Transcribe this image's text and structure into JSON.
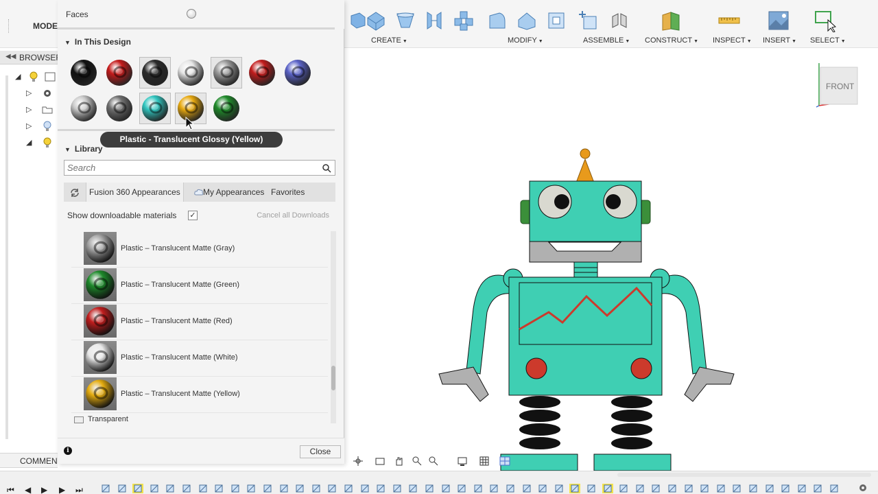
{
  "toolbar": {
    "mode": "MODE",
    "groups": [
      {
        "label": "CREATE"
      },
      {
        "label": "MODIFY"
      },
      {
        "label": "ASSEMBLE"
      },
      {
        "label": "CONSTRUCT"
      },
      {
        "label": "INSPECT"
      },
      {
        "label": "INSERT"
      },
      {
        "label": "SELECT"
      }
    ]
  },
  "browser": {
    "label": "BROWSER",
    "collapse_glyph": "◀◀"
  },
  "comments": {
    "label": "COMMENT"
  },
  "appearance_panel": {
    "faces_label": "Faces",
    "in_this_design": "In This Design",
    "design_swatches": [
      {
        "name": "black-glossy",
        "color": "#111111"
      },
      {
        "name": "red-glossy",
        "color": "#c41a1a"
      },
      {
        "name": "black-matte",
        "color": "#2a2a2a"
      },
      {
        "name": "white",
        "color": "#e6e6e6"
      },
      {
        "name": "gray",
        "color": "#9a9a9a"
      },
      {
        "name": "red",
        "color": "#c21c1c"
      },
      {
        "name": "blue",
        "color": "#5b63c8"
      },
      {
        "name": "chrome",
        "color": "#c9c9c9"
      },
      {
        "name": "dark-chrome",
        "color": "#6f6f6f"
      },
      {
        "name": "cyan",
        "color": "#31c6c0"
      },
      {
        "name": "yellow",
        "color": "#e8a90f"
      },
      {
        "name": "green",
        "color": "#1f8a2a"
      }
    ],
    "tooltip": "Plastic - Translucent Glossy (Yellow)",
    "library": "Library",
    "search_placeholder": "Search",
    "tabs": {
      "fusion": "Fusion 360 Appearances",
      "my": "My Appearances",
      "favorites": "Favorites"
    },
    "show_downloadable": "Show downloadable materials",
    "checkbox_mark": "✓",
    "cancel_downloads": "Cancel all Downloads",
    "materials": [
      {
        "name": "Plastic – Translucent Matte (Gray)",
        "color": "#a5a5a5"
      },
      {
        "name": "Plastic – Translucent Matte (Green)",
        "color": "#1e8a2b"
      },
      {
        "name": "Plastic – Translucent Matte (Red)",
        "color": "#c11d1d"
      },
      {
        "name": "Plastic – Translucent Matte (White)",
        "color": "#e9e9e9"
      },
      {
        "name": "Plastic – Translucent Matte (Yellow)",
        "color": "#e6ad10"
      }
    ],
    "transparent_folder": "Transparent",
    "info_glyph": "i",
    "close": "Close"
  },
  "viewport": {
    "viewcube_face": "FRONT",
    "robot_colors": {
      "teal": "#3fcfb3",
      "gray": "#b0b0b0",
      "red": "#cc3a2c",
      "orange": "#e89a1c",
      "black": "#111111",
      "green": "#3b8f3a"
    }
  },
  "timeline": {
    "controls": [
      "⏮",
      "◀",
      "▶",
      "▶",
      "⏭"
    ]
  }
}
